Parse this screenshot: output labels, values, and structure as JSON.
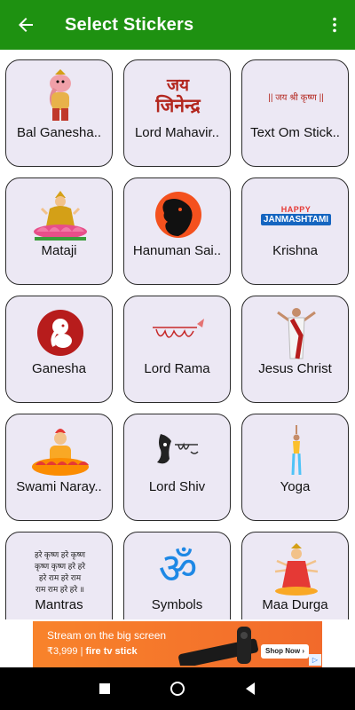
{
  "appbar": {
    "title": "Select Stickers"
  },
  "colors": {
    "appbar": "#1e9111",
    "card_bg": "#ece8f4",
    "card_border": "#2b2b2b",
    "ad_bg": "#f8832b"
  },
  "stickers": [
    {
      "label": "Bal Ganesha..",
      "icon": "bal-ganesha-icon"
    },
    {
      "label": "Lord Mahavir..",
      "icon": "jai-jinendra-text-icon",
      "art_text": [
        "जय",
        "जिनेन्द्र"
      ]
    },
    {
      "label": "Text Om Stick..",
      "icon": "jai-shri-krishna-text-icon",
      "art_text": "|| जय श्री कृष्ण ||"
    },
    {
      "label": "Mataji",
      "icon": "lakshmi-icon"
    },
    {
      "label": "Hanuman Sai..",
      "icon": "hanuman-silhouette-icon"
    },
    {
      "label": "Krishna",
      "icon": "happy-janmashtami-icon",
      "art_text": [
        "HAPPY",
        "JANMASHTAMI"
      ]
    },
    {
      "label": "Ganesha",
      "icon": "ganesha-logo-icon"
    },
    {
      "label": "Lord Rama",
      "icon": "shri-ram-calligraphy-icon"
    },
    {
      "label": "Jesus Christ",
      "icon": "jesus-christ-icon"
    },
    {
      "label": "Swami Naray..",
      "icon": "swaminarayan-icon"
    },
    {
      "label": "Lord Shiv",
      "icon": "shiva-calligraphy-icon"
    },
    {
      "label": "Yoga",
      "icon": "yoga-pose-icon"
    },
    {
      "label": "Mantras",
      "icon": "mantra-text-icon",
      "art_text": [
        "हरे कृष्ण हरे कृष्ण",
        "कृष्ण कृष्ण हरे हरे",
        "हरे राम हरे राम",
        "राम राम हरे हरे ॥"
      ]
    },
    {
      "label": "Symbols",
      "icon": "om-symbol-icon",
      "art_text": "ॐ"
    },
    {
      "label": "Maa Durga",
      "icon": "maa-durga-icon"
    }
  ],
  "ad": {
    "line1": "Stream on the big screen",
    "price": "₹3,999",
    "brand": "fire tv stick",
    "cta": "Shop Now ›",
    "info": "▷"
  }
}
